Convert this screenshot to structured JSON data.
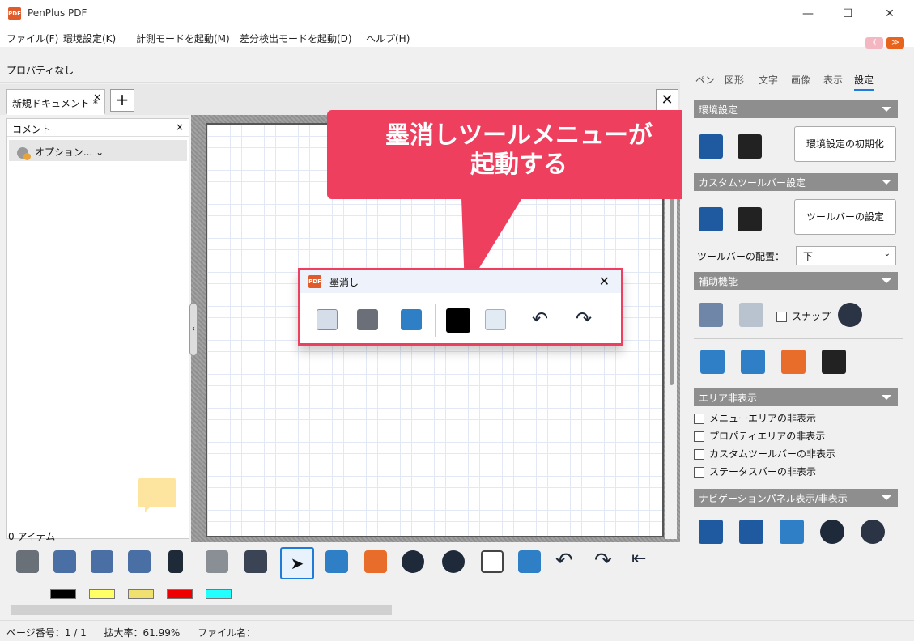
{
  "window": {
    "title": "PenPlus PDF",
    "app_icon": "PDF",
    "minimize": "—",
    "maximize": "☐",
    "close": "✕"
  },
  "menu": [
    "ファイル(F)",
    "環境設定(K)",
    "計測モードを起動(M)",
    "差分検出モードを起動(D)",
    "ヘルプ(H)"
  ],
  "nav_buttons": {
    "prev": "⟪",
    "next": "≫"
  },
  "property_bar": {
    "text": "プロパティなし"
  },
  "tabs": {
    "document": "新規ドキュメント *",
    "tab_close": "×",
    "add": "+",
    "close_all": "✕"
  },
  "comment_panel": {
    "title": "コメント",
    "close": "×",
    "options": "オプション... ⌄",
    "item_count": "0 アイテム"
  },
  "callout": {
    "line1": "墨消しツールメニューが",
    "line2": "起動する"
  },
  "blackout_dialog": {
    "title": "墨消し",
    "close": "✕"
  },
  "swatches": [
    "#000000",
    "#ffff66",
    "#f0e070",
    "#ee0000",
    "#22ffff"
  ],
  "status": {
    "page": "ページ番号：1 / 1",
    "zoom": "拡大率：61.99%",
    "file": "ファイル名："
  },
  "right_panel": {
    "tabs": [
      "ペン",
      "図形",
      "文字",
      "画像",
      "表示",
      "設定"
    ],
    "active_tab": "設定",
    "env_section": "環境設定",
    "env_reset": "環境設定の初期化",
    "toolbar_section": "カスタムツールバー設定",
    "toolbar_settings": "ツールバーの設定",
    "toolbar_position_label": "ツールバーの配置：",
    "toolbar_position_value": "下",
    "assist_section": "補助機能",
    "snap": "スナップ",
    "hide_section": "エリア非表示",
    "hide_options": [
      "メニューエリアの非表示",
      "プロパティエリアの非表示",
      "カスタムツールバーの非表示",
      "ステータスバーの非表示"
    ],
    "nav_section": "ナビゲーションパネル表示/非表示"
  }
}
